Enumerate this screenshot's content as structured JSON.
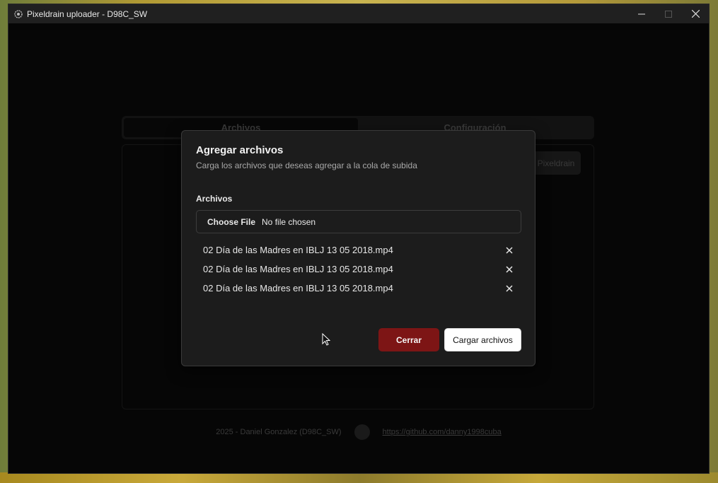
{
  "window": {
    "title": "Pixeldrain uploader - D98C_SW",
    "controls": [
      "minimize-icon",
      "maximize-icon",
      "close-icon"
    ]
  },
  "background_app": {
    "tabs": [
      {
        "label": "Archivos",
        "active": true
      },
      {
        "label": "Configuración",
        "active": false
      }
    ],
    "panel_button_label": "Pixeldrain",
    "footer": {
      "credit": "2025 - Daniel Gonzalez (D98C_SW)",
      "link": "https://github.com/danny1998cuba"
    }
  },
  "modal": {
    "title": "Agregar archivos",
    "subtitle": "Carga los archivos que deseas agregar a la cola de subida",
    "field_label": "Archivos",
    "file_input": {
      "button_label": "Choose File",
      "status": "No file chosen"
    },
    "files": [
      {
        "name": "02 Día de las Madres en IBLJ 13 05 2018.mp4"
      },
      {
        "name": "02 Día de las Madres en IBLJ 13 05 2018.mp4"
      },
      {
        "name": "02 Día de las Madres en IBLJ 13 05 2018.mp4"
      }
    ],
    "buttons": {
      "close": "Cerrar",
      "upload": "Cargar archivos"
    }
  },
  "colors": {
    "close_button": "#7d1515",
    "upload_button": "#ffffff",
    "modal_bg": "#1c1c1c"
  }
}
